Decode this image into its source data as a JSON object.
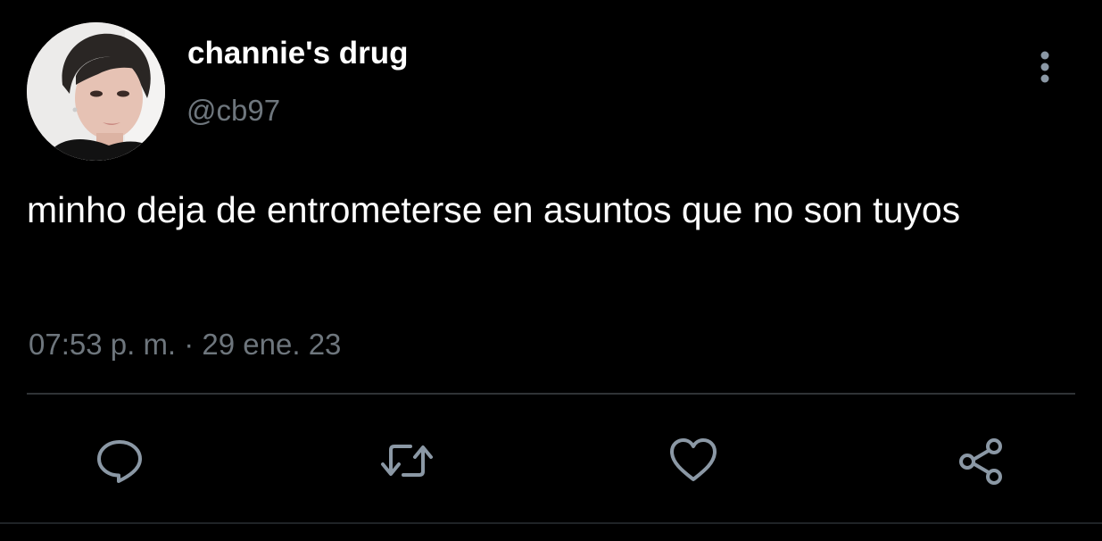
{
  "tweet": {
    "author": {
      "display_name": "channie's drug",
      "handle": "@cb97"
    },
    "text": "minho deja de entrometerse en asuntos que no son tuyos",
    "timestamp": "07:53 p. m. · 29 ene. 23"
  },
  "actions": [
    {
      "name": "reply",
      "icon": "comment-icon"
    },
    {
      "name": "retweet",
      "icon": "retweet-icon"
    },
    {
      "name": "like",
      "icon": "heart-icon"
    },
    {
      "name": "share",
      "icon": "share-icon"
    }
  ],
  "colors": {
    "background": "#000000",
    "primary_text": "#ffffff",
    "secondary_text": "#6e767d",
    "icon": "#8b98a5",
    "divider": "#2f3336"
  }
}
